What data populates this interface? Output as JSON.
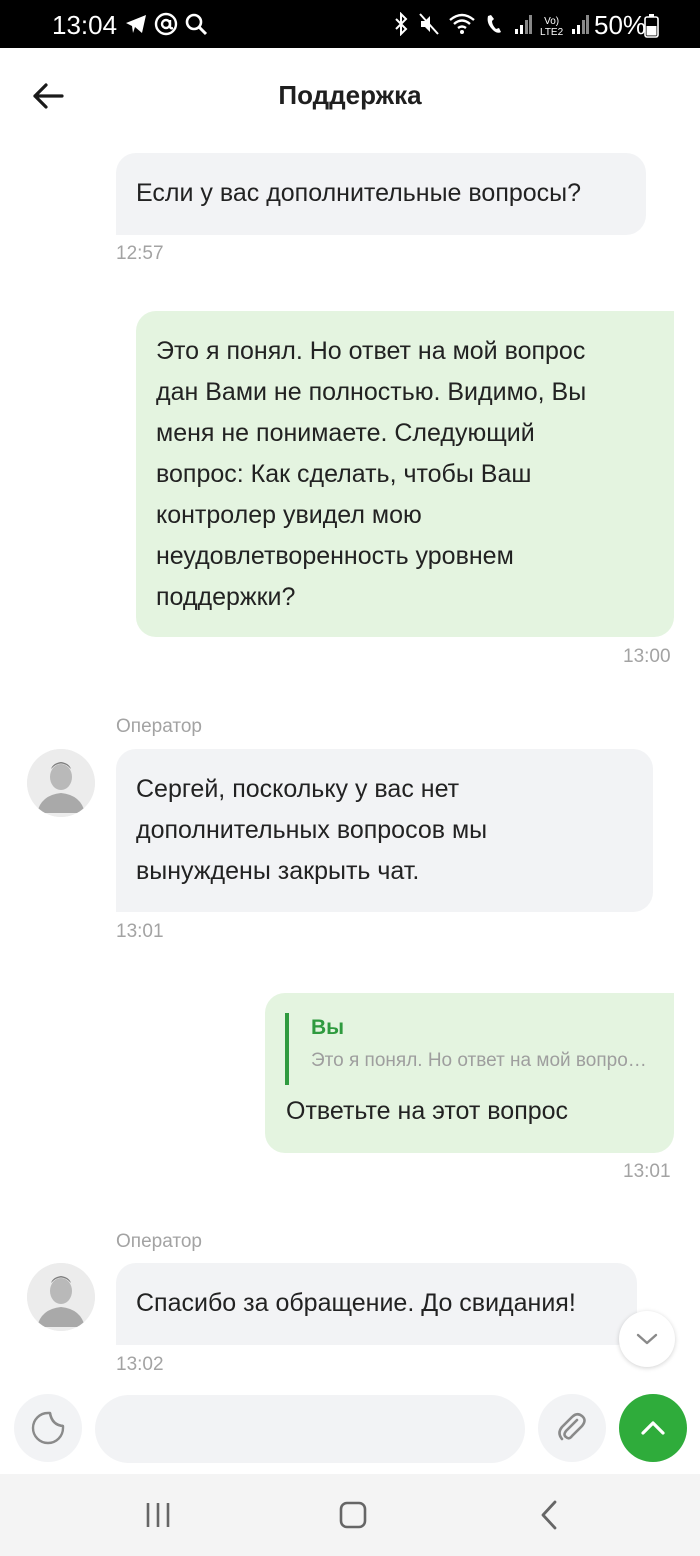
{
  "status_bar": {
    "time": "13:04",
    "battery": "50%",
    "left_icons": [
      "telegram-icon",
      "at-icon",
      "search-icon"
    ],
    "right_icons": [
      "bluetooth-icon",
      "mute-icon",
      "wifi-icon",
      "call-icon",
      "signal-icon",
      "volte-icon",
      "signal-icon",
      "battery-icon"
    ],
    "network_label_1": "Vo)",
    "network_label_2": "LTE2"
  },
  "header": {
    "title": "Поддержка",
    "back_icon": "arrow-left-icon"
  },
  "messages": [
    {
      "direction": "in",
      "text": "Если у вас дополнительные вопросы?",
      "time": "12:57"
    },
    {
      "direction": "out",
      "lines": [
        "Это я понял. Но ответ на мой вопрос",
        "дан Вами не полностью. Видимо, Вы",
        "меня не понимаете. Следующий",
        "вопрос: Как сделать, чтобы Ваш",
        "контролер увидел мою",
        "неудовлетворенность уровнем",
        "поддержки?"
      ],
      "time": "13:00"
    },
    {
      "direction": "in",
      "sender": "Оператор",
      "lines": [
        "Сергей, поскольку у вас нет",
        "дополнительных вопросов мы",
        "вынуждены закрыть чат."
      ],
      "time": "13:01"
    },
    {
      "direction": "out",
      "quote_author": "Вы",
      "quote_text": "Это я понял. Но ответ на мой вопрос дан Вами не полностью.",
      "text": "Ответьте на этот вопрос",
      "time": "13:01"
    },
    {
      "direction": "in",
      "sender": "Оператор",
      "text": "Спасибо за обращение. До свидания!",
      "time": "13:02"
    }
  ],
  "input": {
    "value": "",
    "placeholder": "",
    "sticker_icon": "sticker-icon",
    "attach_icon": "paperclip-icon",
    "send_icon": "chevron-up-icon"
  },
  "scroll_button_icon": "chevron-down-icon",
  "nav_bar": [
    "recent-apps-icon",
    "home-icon",
    "back-icon"
  ],
  "colors": {
    "accent": "#2fac3b",
    "incoming_bubble": "#f2f3f5",
    "outgoing_bubble": "#e4f4e0",
    "quote_accent": "#2f9a3f"
  }
}
